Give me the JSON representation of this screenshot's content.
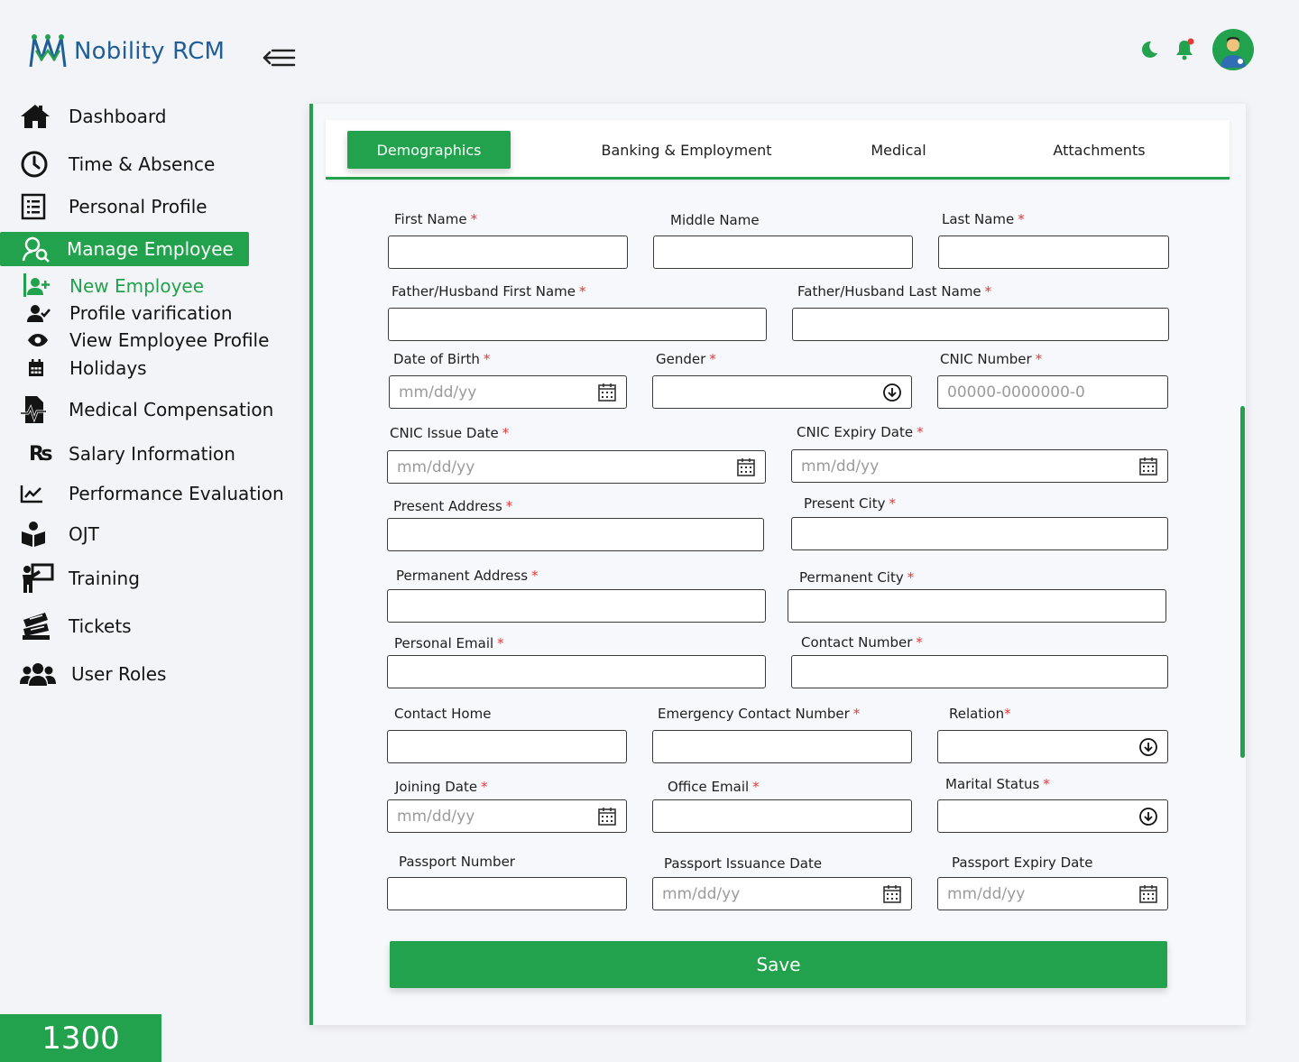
{
  "app": {
    "name": "Nobility RCM"
  },
  "colors": {
    "accent": "#22a24c",
    "brand": "#1f5e96",
    "required": "#e53935"
  },
  "sidebar": {
    "items": [
      {
        "label": "Dashboard",
        "icon": "home-icon"
      },
      {
        "label": "Time & Absence",
        "icon": "clock-icon"
      },
      {
        "label": "Personal Profile",
        "icon": "list-icon"
      },
      {
        "label": "Manage Employee",
        "icon": "user-search-icon",
        "active": true
      },
      {
        "label": "Medical Compensation",
        "icon": "medical-file-icon"
      },
      {
        "label": "Salary Information",
        "icon": "rupee-icon"
      },
      {
        "label": "Performance Evaluation",
        "icon": "chart-line-icon"
      },
      {
        "label": "OJT",
        "icon": "reader-icon"
      },
      {
        "label": "Training",
        "icon": "trainer-icon"
      },
      {
        "label": "Tickets",
        "icon": "tickets-icon"
      },
      {
        "label": "User Roles",
        "icon": "users-icon"
      }
    ],
    "sub_items": [
      {
        "label": "New Employee",
        "icon": "user-plus-icon",
        "current": true
      },
      {
        "label": "Profile varification",
        "icon": "user-check-icon"
      },
      {
        "label": "View Employee Profile",
        "icon": "eye-icon"
      },
      {
        "label": "Holidays",
        "icon": "calendar-icon"
      }
    ]
  },
  "footer": {
    "badge": "1300"
  },
  "tabs": [
    {
      "label": "Demographics",
      "active": true
    },
    {
      "label": "Banking & Employment"
    },
    {
      "label": "Medical"
    },
    {
      "label": "Attachments"
    }
  ],
  "form": {
    "date_placeholder": "mm/dd/yy",
    "cnic_placeholder": "00000-0000000-0",
    "fields": {
      "first_name": {
        "label": "First Name",
        "required": "*"
      },
      "middle_name": {
        "label": "Middle Name"
      },
      "last_name": {
        "label": "Last Name",
        "required": "*"
      },
      "father_first": {
        "label": "Father/Husband First Name",
        "required": "*"
      },
      "father_last": {
        "label": "Father/Husband Last Name",
        "required": "*"
      },
      "dob": {
        "label": "Date of Birth",
        "required": "*"
      },
      "gender": {
        "label": "Gender",
        "required": "*"
      },
      "cnic_number": {
        "label": "CNIC Number",
        "required": "*"
      },
      "cnic_issue": {
        "label": "CNIC Issue Date",
        "required": "*"
      },
      "cnic_expiry": {
        "label": "CNIC Expiry Date",
        "required": "*"
      },
      "present_address": {
        "label": "Present Address",
        "required": "*"
      },
      "present_city": {
        "label": "Present City",
        "required": "*"
      },
      "permanent_address": {
        "label": "Permanent Address",
        "required": "*"
      },
      "permanent_city": {
        "label": "Permanent City",
        "required": "*"
      },
      "personal_email": {
        "label": "Personal Email",
        "required": "*"
      },
      "contact_number": {
        "label": "Contact Number",
        "required": "*"
      },
      "contact_home": {
        "label": "Contact Home"
      },
      "emergency_contact": {
        "label": "Emergency Contact Number",
        "required": "*"
      },
      "relation": {
        "label": "Relation",
        "required": "*"
      },
      "joining_date": {
        "label": "Joining Date",
        "required": "*"
      },
      "office_email": {
        "label": "Office Email",
        "required": "*"
      },
      "marital_status": {
        "label": "Marital Status",
        "required": "*"
      },
      "passport_number": {
        "label": "Passport Number"
      },
      "passport_issuance": {
        "label": "Passport Issuance Date"
      },
      "passport_expiry": {
        "label": "Passport Expiry Date"
      }
    },
    "save_label": "Save"
  }
}
